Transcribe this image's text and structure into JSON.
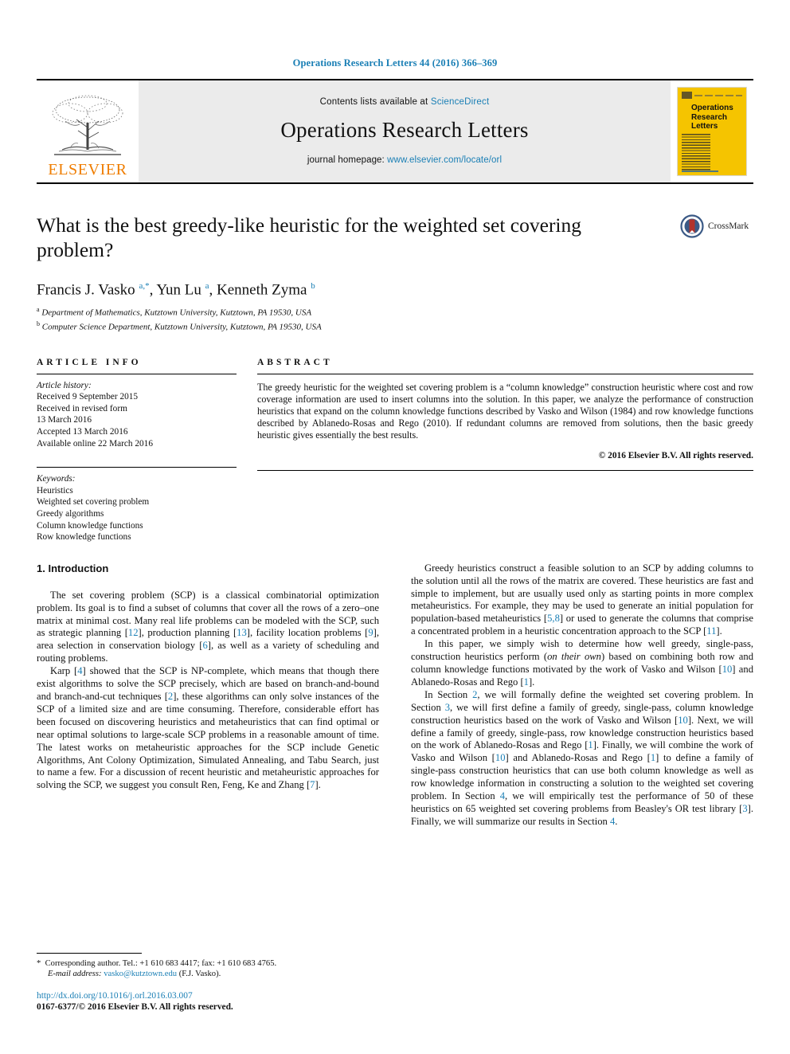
{
  "running_head": "Operations Research Letters 44 (2016) 366–369",
  "masthead": {
    "publisher_name": "ELSEVIER",
    "contents_prefix": "Contents lists available at ",
    "contents_link": "ScienceDirect",
    "journal_title": "Operations Research Letters",
    "homepage_prefix": "journal homepage: ",
    "homepage_url": "www.elsevier.com/locate/orl",
    "cover_title_line1": "Operations",
    "cover_title_line2": "Research",
    "cover_title_line3": "Letters"
  },
  "article": {
    "title": "What is the best greedy-like heuristic for the weighted set covering problem?",
    "crossmark_label": "CrossMark",
    "authors_html": "Francis J. Vasko <sup>a,*</sup>, Yun Lu <sup>a</sup>, Kenneth Zyma <sup>b</sup>",
    "affiliation_a": "Department of Mathematics, Kutztown University, Kutztown, PA 19530, USA",
    "affiliation_b": "Computer Science Department, Kutztown University, Kutztown, PA 19530, USA"
  },
  "article_info": {
    "heading": "ARTICLE INFO",
    "history_label": "Article history:",
    "history": [
      "Received 9 September 2015",
      "Received in revised form",
      "13 March 2016",
      "Accepted 13 March 2016",
      "Available online 22 March 2016"
    ],
    "keywords_label": "Keywords:",
    "keywords": [
      "Heuristics",
      "Weighted set covering problem",
      "Greedy algorithms",
      "Column knowledge functions",
      "Row knowledge functions"
    ]
  },
  "abstract": {
    "heading": "ABSTRACT",
    "text": "The greedy heuristic for the weighted set covering problem is a “column knowledge” construction heuristic where cost and row coverage information are used to insert columns into the solution. In this paper, we analyze the performance of construction heuristics that expand on the column knowledge functions described by Vasko and Wilson (1984) and row knowledge functions described by Ablanedo-Rosas and Rego (2010). If redundant columns are removed from solutions, then the basic greedy heuristic gives essentially the best results.",
    "copyright": "© 2016 Elsevier B.V. All rights reserved."
  },
  "body": {
    "section_title": "1. Introduction",
    "left_paragraphs": [
      {
        "parts": [
          {
            "t": "The set covering problem (SCP) is a classical combinatorial optimization problem. Its goal is to find a subset of columns that cover all the rows of a zero–one matrix at minimal cost. Many real life problems can be modeled with the SCP, such as strategic planning ["
          },
          {
            "t": "12",
            "ref": true
          },
          {
            "t": "], production planning ["
          },
          {
            "t": "13",
            "ref": true
          },
          {
            "t": "], facility location problems ["
          },
          {
            "t": "9",
            "ref": true
          },
          {
            "t": "], area selection in conservation biology ["
          },
          {
            "t": "6",
            "ref": true
          },
          {
            "t": "], as well as a variety of scheduling and routing problems."
          }
        ]
      },
      {
        "parts": [
          {
            "t": "Karp ["
          },
          {
            "t": "4",
            "ref": true
          },
          {
            "t": "] showed that the SCP is NP-complete, which means that though there exist algorithms to solve the SCP precisely, which are based on branch-and-bound and branch-and-cut techniques ["
          },
          {
            "t": "2",
            "ref": true
          },
          {
            "t": "], these algorithms can only solve instances of the SCP of a limited size and are time consuming. Therefore, considerable effort has been focused on discovering heuristics and metaheuristics that can find optimal or near optimal solutions to large-scale SCP problems in a reasonable amount of time. The latest works on metaheuristic approaches for the SCP include Genetic Algorithms, Ant Colony Optimization, Simulated Annealing, and Tabu Search, just to name a few. For a discussion of recent heuristic and metaheuristic approaches for solving the SCP, we suggest you consult Ren, Feng, Ke and Zhang ["
          },
          {
            "t": "7",
            "ref": true
          },
          {
            "t": "]."
          }
        ]
      }
    ],
    "right_paragraphs": [
      {
        "parts": [
          {
            "t": "Greedy heuristics construct a feasible solution to an SCP by adding columns to the solution until all the rows of the matrix are covered. These heuristics are fast and simple to implement, but are usually used only as starting points in more complex metaheuristics. For example, they may be used to generate an initial population for population-based metaheuristics ["
          },
          {
            "t": "5,8",
            "ref": true
          },
          {
            "t": "] or used to generate the columns that comprise a concentrated problem in a heuristic concentration approach to the SCP ["
          },
          {
            "t": "11",
            "ref": true
          },
          {
            "t": "]."
          }
        ]
      },
      {
        "parts": [
          {
            "t": "In this paper, we simply wish to determine how well greedy, single-pass, construction heuristics perform ("
          },
          {
            "t": "on their own",
            "ital": true
          },
          {
            "t": ") based on combining both row and column knowledge functions motivated by the work of Vasko and Wilson ["
          },
          {
            "t": "10",
            "ref": true
          },
          {
            "t": "] and Ablanedo-Rosas and Rego ["
          },
          {
            "t": "1",
            "ref": true
          },
          {
            "t": "]."
          }
        ]
      },
      {
        "parts": [
          {
            "t": "In Section "
          },
          {
            "t": "2",
            "ref": true
          },
          {
            "t": ", we will formally define the weighted set covering problem. In Section "
          },
          {
            "t": "3",
            "ref": true
          },
          {
            "t": ", we will first define a family of greedy, single-pass, column knowledge construction heuristics based on the work of Vasko and Wilson ["
          },
          {
            "t": "10",
            "ref": true
          },
          {
            "t": "]. Next, we will define a family of greedy, single-pass, row knowledge construction heuristics based on the work of Ablanedo-Rosas and Rego ["
          },
          {
            "t": "1",
            "ref": true
          },
          {
            "t": "]. Finally, we will combine the work of Vasko and Wilson ["
          },
          {
            "t": "10",
            "ref": true
          },
          {
            "t": "] and Ablanedo-Rosas and Rego ["
          },
          {
            "t": "1",
            "ref": true
          },
          {
            "t": "] to define a family of single-pass construction heuristics that can use both column knowledge as well as row knowledge information in constructing a solution to the weighted set covering problem. In Section "
          },
          {
            "t": "4",
            "ref": true
          },
          {
            "t": ", we will empirically test the performance of 50 of these heuristics on 65 weighted set covering problems from Beasley's OR test library ["
          },
          {
            "t": "3",
            "ref": true
          },
          {
            "t": "]. Finally, we will summarize our results in Section "
          },
          {
            "t": "4",
            "ref": true
          },
          {
            "t": "."
          }
        ]
      }
    ]
  },
  "footnotes": {
    "corresponding_marker": "*",
    "corresponding_text": "Corresponding author. Tel.: +1 610 683 4417; fax: +1 610 683 4765.",
    "email_label": "E-mail address:",
    "email_link": "vasko@kutztown.edu",
    "email_suffix": "(F.J. Vasko).",
    "doi": "http://dx.doi.org/10.1016/j.orl.2016.03.007",
    "issn": "0167-6377/© 2016 Elsevier B.V. All rights reserved."
  },
  "colors": {
    "link_blue": "#1a7fb5",
    "elsevier_orange": "#ef7d00",
    "cover_yellow": "#f5c400",
    "masthead_gray": "#ebebeb"
  }
}
